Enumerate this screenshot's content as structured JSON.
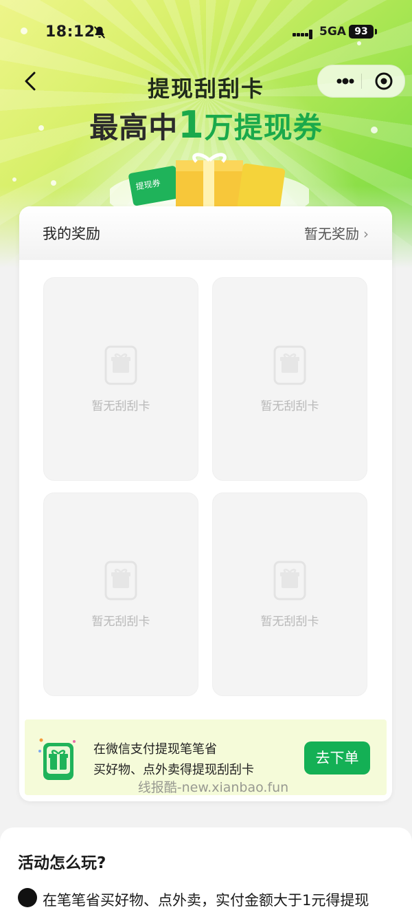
{
  "status_bar": {
    "time": "18:12",
    "network": "5GA",
    "battery": "93"
  },
  "header": {
    "title": "提现刮刮卡",
    "subtitle_prefix": "最高中",
    "subtitle_number": "1",
    "subtitle_suffix": "万提现券"
  },
  "hero": {
    "voucher_label": "提现券"
  },
  "rewards": {
    "title": "我的奖励",
    "status": "暂无奖励",
    "slots": [
      {
        "label": "暂无刮刮卡"
      },
      {
        "label": "暂无刮刮卡"
      },
      {
        "label": "暂无刮刮卡"
      },
      {
        "label": "暂无刮刮卡"
      }
    ]
  },
  "watermark": "线报酷-new.xianbao.fun",
  "promo": {
    "line1": "在微信支付提现笔笔省",
    "line2": "买好物、点外卖得提现刮刮卡",
    "button": "去下单"
  },
  "howto": {
    "title": "活动怎么玩?",
    "step1": "在笔笔省买好物、点外卖，实付金额大于1元得提现"
  },
  "colors": {
    "brand_green": "#14b055",
    "title_green": "#1aa94b"
  }
}
